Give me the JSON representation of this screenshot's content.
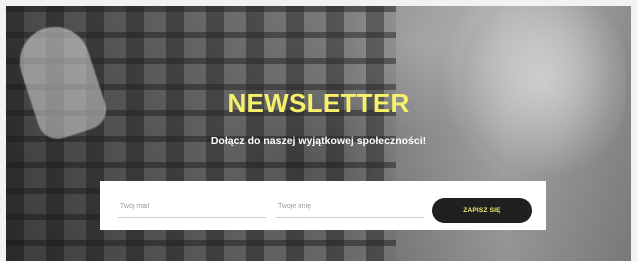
{
  "newsletter": {
    "title": "NEWSLETTER",
    "subtitle": "Dołącz do naszej wyjątkowej społeczności!",
    "email_placeholder": "Twój mail",
    "name_placeholder": "Twoje imię",
    "submit_label": "ZAPISZ SIĘ"
  },
  "colors": {
    "accent_yellow": "#f6f06a",
    "button_dark": "#202020",
    "form_bg": "#ffffff"
  }
}
